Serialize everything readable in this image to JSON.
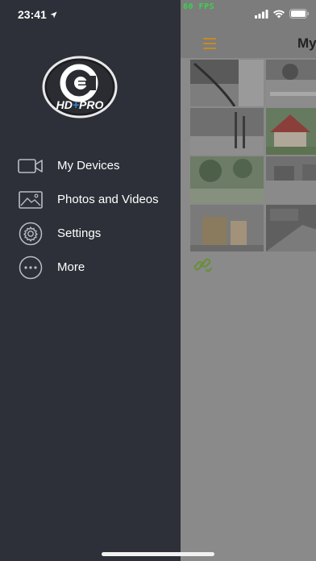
{
  "status_bar": {
    "time": "23:41",
    "fps": "60 FPS"
  },
  "main_screen": {
    "title": "My",
    "tiles": [
      {
        "name": "camera-tile-1"
      },
      {
        "name": "camera-tile-2"
      },
      {
        "name": "camera-tile-3"
      },
      {
        "name": "camera-tile-4"
      },
      {
        "name": "camera-tile-5"
      },
      {
        "name": "camera-tile-6"
      },
      {
        "name": "camera-tile-7"
      },
      {
        "name": "camera-tile-8"
      }
    ]
  },
  "drawer": {
    "logo_text": "HD+PRO",
    "items": [
      {
        "label": "My Devices",
        "icon": "video-camera-icon"
      },
      {
        "label": "Photos and Videos",
        "icon": "photo-icon"
      },
      {
        "label": "Settings",
        "icon": "gear-icon"
      },
      {
        "label": "More",
        "icon": "more-icon"
      }
    ]
  },
  "colors": {
    "drawer_bg": "#2d3038",
    "overlay": "#8a8a8a",
    "accent": "#c58c1d",
    "fps": "#32d74b"
  }
}
